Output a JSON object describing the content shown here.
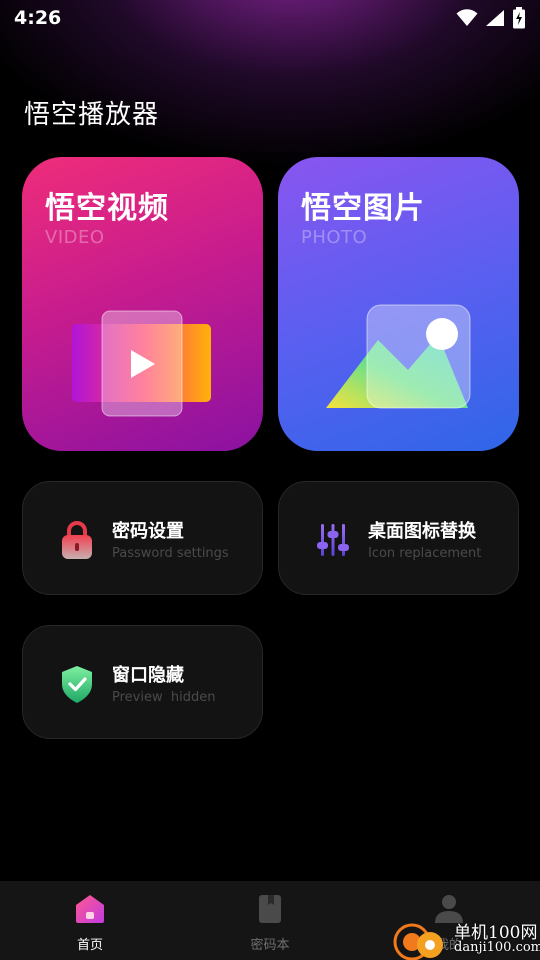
{
  "status_bar": {
    "time": "4:26",
    "icons": [
      "wifi-icon",
      "signal-icon",
      "battery-charging-icon"
    ]
  },
  "app": {
    "title": "悟空播放器"
  },
  "cards": {
    "video": {
      "title": "悟空视频",
      "subtitle": "VIDEO",
      "icon": "video-play-icon"
    },
    "photo": {
      "title": "悟空图片",
      "subtitle": "PHOTO",
      "icon": "photo-icon"
    }
  },
  "features": [
    {
      "title": "密码设置",
      "subtitle": "Password settings",
      "icon": "lock-icon"
    },
    {
      "title": "桌面图标替换",
      "subtitle": "Icon replacement",
      "icon": "sliders-icon"
    },
    {
      "title": "窗口隐藏",
      "subtitle": "Preview  hidden",
      "icon": "shield-check-icon"
    }
  ],
  "nav": {
    "items": [
      {
        "label": "首页",
        "icon": "home-icon",
        "active": true
      },
      {
        "label": "密码本",
        "icon": "bookmark-icon",
        "active": false
      },
      {
        "label": "我的",
        "icon": "user-icon",
        "active": false
      }
    ]
  },
  "watermark": {
    "line1": "单机100网",
    "line2": "danji100.com"
  },
  "colors": {
    "background": "#000000",
    "video_card": "#d01f88",
    "photo_card": "#5a5ff0",
    "feature_card": "#131313",
    "text_muted": "#4a4a4a"
  }
}
